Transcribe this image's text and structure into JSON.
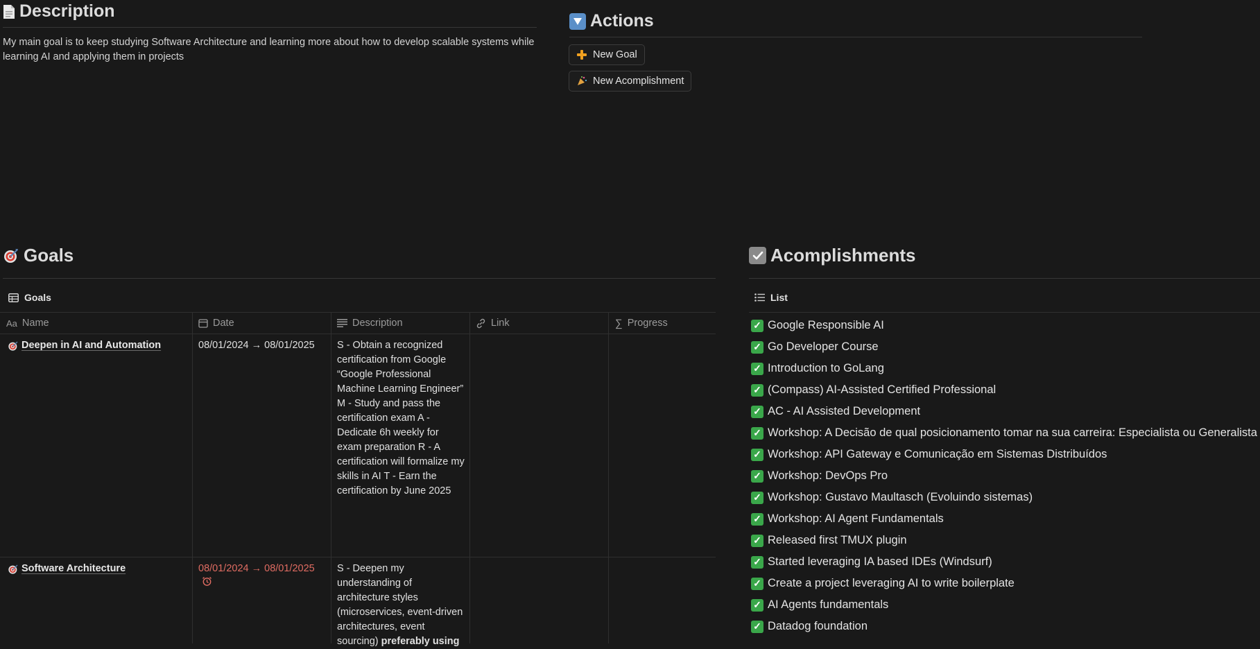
{
  "description": {
    "title": "Description",
    "icon": "page-icon",
    "text": "My main goal is to keep studying Software Architecture and learning more about how to develop scalable systems while learning AI and applying them in projects"
  },
  "actions": {
    "title": "Actions",
    "icon": "triangle-down-icon",
    "buttons": [
      {
        "icon": "plus-icon",
        "label": "New Goal"
      },
      {
        "icon": "party-popper-icon",
        "label": "New Acomplishment"
      }
    ]
  },
  "goals": {
    "title": "Goals",
    "icon": "target-icon",
    "view_label": "Goals",
    "columns": [
      "Name",
      "Date",
      "Description",
      "Link",
      "Progress"
    ],
    "rows": [
      {
        "name": "Deepen in AI and Automation",
        "date": "08/01/2024 → 08/01/2025",
        "description": "S - Obtain a recognized certification from Google “Google Professional Machine Learning Engineer” M - Study and pass the certification exam A - Dedicate 6h weekly for exam preparation R - A certification will formalize my skills in AI T - Earn the certification by June 2025",
        "link": "",
        "progress": ""
      },
      {
        "name": "Software Architecture",
        "date": "08/01/2024 → 08/01/2025",
        "date_overdue": true,
        "description": "S - Deepen my understanding of architecture styles (microservices, event-driven architectures, event sourcing)",
        "description_bold": "preferably using",
        "link": "",
        "progress": ""
      }
    ]
  },
  "accomplishments": {
    "title": "Acomplishments",
    "icon": "check-box-icon",
    "view_label": "List",
    "items": [
      "Google Responsible AI",
      "Go Developer Course",
      "Introduction to GoLang",
      "(Compass) AI-Assisted Certified Professional",
      "AC - AI Assisted Development",
      "Workshop: A Decisão de qual posicionamento tomar na sua carreira: Especialista ou Generalista",
      "Workshop: API Gateway e Comunicação em Sistemas Distribuídos",
      "Workshop: DevOps Pro",
      "Workshop: Gustavo Maultasch (Evoluindo sistemas)",
      "Workshop: AI Agent Fundamentals",
      "Released first TMUX plugin",
      "Started leveraging IA based IDEs (Windsurf)",
      "Create a project leveraging AI to write boilerplate",
      "AI Agents fundamentals",
      "Datadog foundation"
    ]
  },
  "colors": {
    "background": "#191919",
    "overdue": "#e06c62",
    "check": "#3aa74a"
  }
}
